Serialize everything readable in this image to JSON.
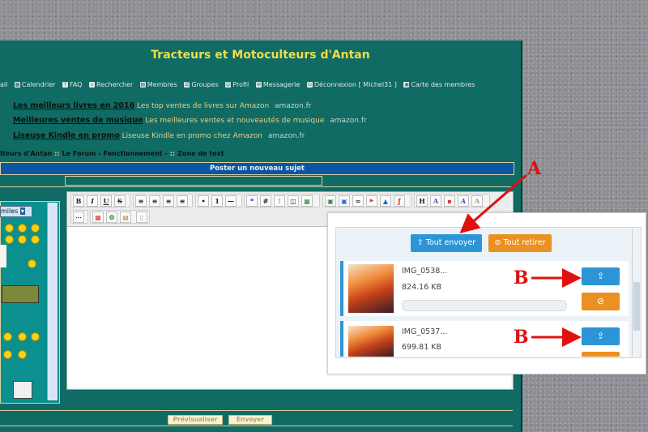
{
  "site_title": "Tracteurs et Motoculteurs d'Antan",
  "nav": [
    {
      "icon": "mail-icon",
      "label": "ail"
    },
    {
      "icon": "calendar-icon",
      "label": "Calendrier"
    },
    {
      "icon": "faq-icon",
      "label": "FAQ"
    },
    {
      "icon": "search-icon",
      "label": "Rechercher"
    },
    {
      "icon": "members-icon",
      "label": "Membres"
    },
    {
      "icon": "groups-icon",
      "label": "Groupes"
    },
    {
      "icon": "profile-icon",
      "label": "Profil"
    },
    {
      "icon": "messages-icon",
      "label": "Messagerie"
    },
    {
      "icon": "logout-icon",
      "label": "Déconnexion [ Michel31 ]"
    },
    {
      "icon": "map-icon",
      "label": "Carte des membres"
    }
  ],
  "ads": [
    {
      "title": "Les meilleurs livres en 2016",
      "text": "Les top ventes de livres sur Amazon",
      "domain": "amazon.fr"
    },
    {
      "title": "Meilleures ventes de musique",
      "text": "Les meilleures ventes et nouveautés de musique",
      "domain": "amazon.fr"
    },
    {
      "title": "Liseuse Kindle en promo",
      "text": "Liseuse Kindle en promo chez Amazon",
      "domain": "amazon.fr"
    }
  ],
  "breadcrumb": [
    "lteurs d'Antan",
    "Le Forum - Fonctionnement -",
    "Zone de text"
  ],
  "post_bar_title": "Poster un nouveau sujet",
  "smileys_select": "miles",
  "toolbar_text_buttons": [
    "B",
    "I",
    "U",
    "S"
  ],
  "buttons": {
    "preview": "Prévisualiser",
    "send": "Envoyer"
  },
  "upload": {
    "send_all": "Tout envoyer",
    "remove_all": "Tout retirer",
    "files": [
      {
        "name": "IMG_0538...",
        "size": "824.16 KB"
      },
      {
        "name": "IMG_0537...",
        "size": "699.81 KB"
      }
    ]
  },
  "annotations": {
    "a": "A",
    "b": "B"
  },
  "colors": {
    "forum_bg": "#0f6b63",
    "title": "#f2dc48",
    "accent_blue": "#2d95d6",
    "accent_orange": "#eb9022",
    "annotation_red": "#e01010"
  }
}
